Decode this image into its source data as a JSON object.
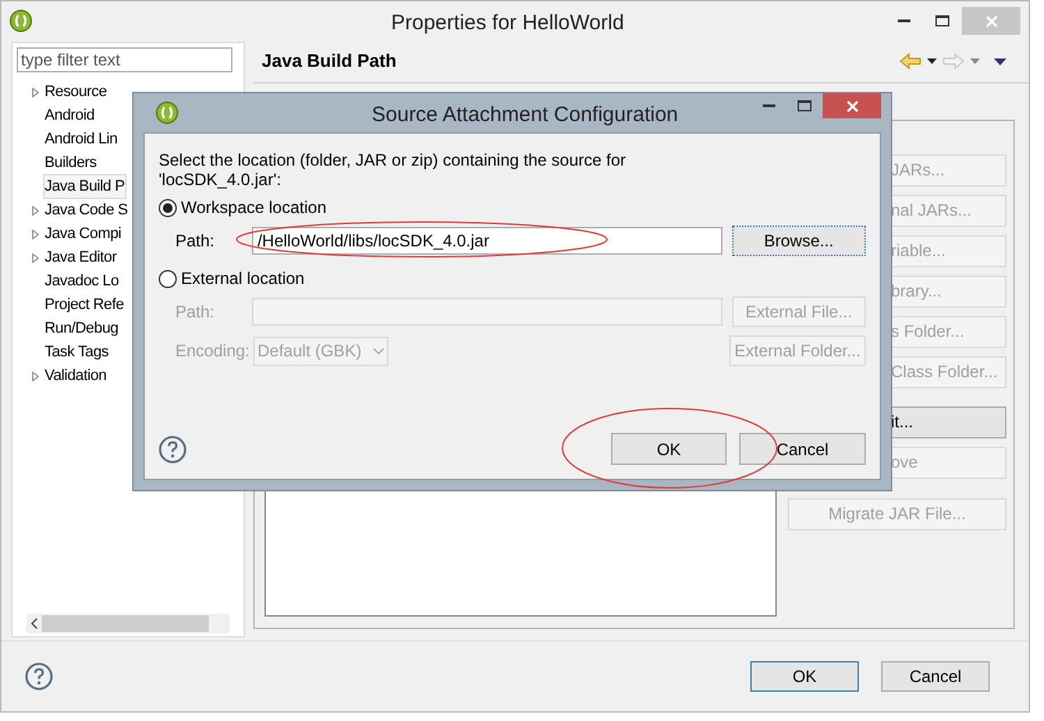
{
  "window": {
    "title": "Properties for HelloWorld"
  },
  "filter": {
    "placeholder": "type filter text"
  },
  "tree": [
    {
      "label": "Resource",
      "kind": "group",
      "selected": false
    },
    {
      "label": "Android",
      "kind": "leaf",
      "selected": false
    },
    {
      "label": "Android Lin",
      "kind": "leaf",
      "selected": false
    },
    {
      "label": "Builders",
      "kind": "leaf",
      "selected": false
    },
    {
      "label": "Java Build P",
      "kind": "leaf",
      "selected": true
    },
    {
      "label": "Java Code S",
      "kind": "group",
      "selected": false
    },
    {
      "label": "Java Compi",
      "kind": "group",
      "selected": false
    },
    {
      "label": "Java Editor",
      "kind": "group",
      "selected": false
    },
    {
      "label": "Javadoc Lo",
      "kind": "leaf",
      "selected": false
    },
    {
      "label": "Project Refe",
      "kind": "leaf",
      "selected": false
    },
    {
      "label": "Run/Debug",
      "kind": "leaf",
      "selected": false
    },
    {
      "label": "Task Tags",
      "kind": "leaf",
      "selected": false
    },
    {
      "label": "Validation",
      "kind": "group",
      "selected": false
    }
  ],
  "page": {
    "title": "Java Build Path"
  },
  "side_button_groups": [
    {
      "buttons": [
        {
          "label": "JARs...",
          "disabled": true
        },
        {
          "label": "nal JARs...",
          "disabled": true
        },
        {
          "label": "riable...",
          "disabled": true
        },
        {
          "label": "brary...",
          "disabled": true
        },
        {
          "label": "s Folder...",
          "disabled": true
        },
        {
          "label": "Class Folder...",
          "disabled": true
        }
      ]
    },
    {
      "buttons": [
        {
          "label": "it...",
          "disabled": false
        },
        {
          "label": "ove",
          "disabled": true
        }
      ]
    }
  ],
  "migrate_button": {
    "label": "Migrate JAR File...",
    "disabled": true
  },
  "dialog": {
    "title": "Source Attachment Configuration",
    "message": "Select the location (folder, JAR or zip) containing the source for 'locSDK_4.0.jar':",
    "workspace": {
      "label": "Workspace location",
      "selected": true,
      "path_label": "Path:",
      "path_value": "/HelloWorld/libs/locSDK_4.0.jar",
      "button": "Browse..."
    },
    "external": {
      "label": "External location",
      "selected": false,
      "path_label": "Path:",
      "encoding_label": "Encoding:",
      "encoding_value": "Default (GBK)",
      "file_button": "External File...",
      "folder_button": "External Folder..."
    },
    "ok": "OK",
    "cancel": "Cancel"
  },
  "buttons": [
    "OK",
    "Cancel"
  ]
}
